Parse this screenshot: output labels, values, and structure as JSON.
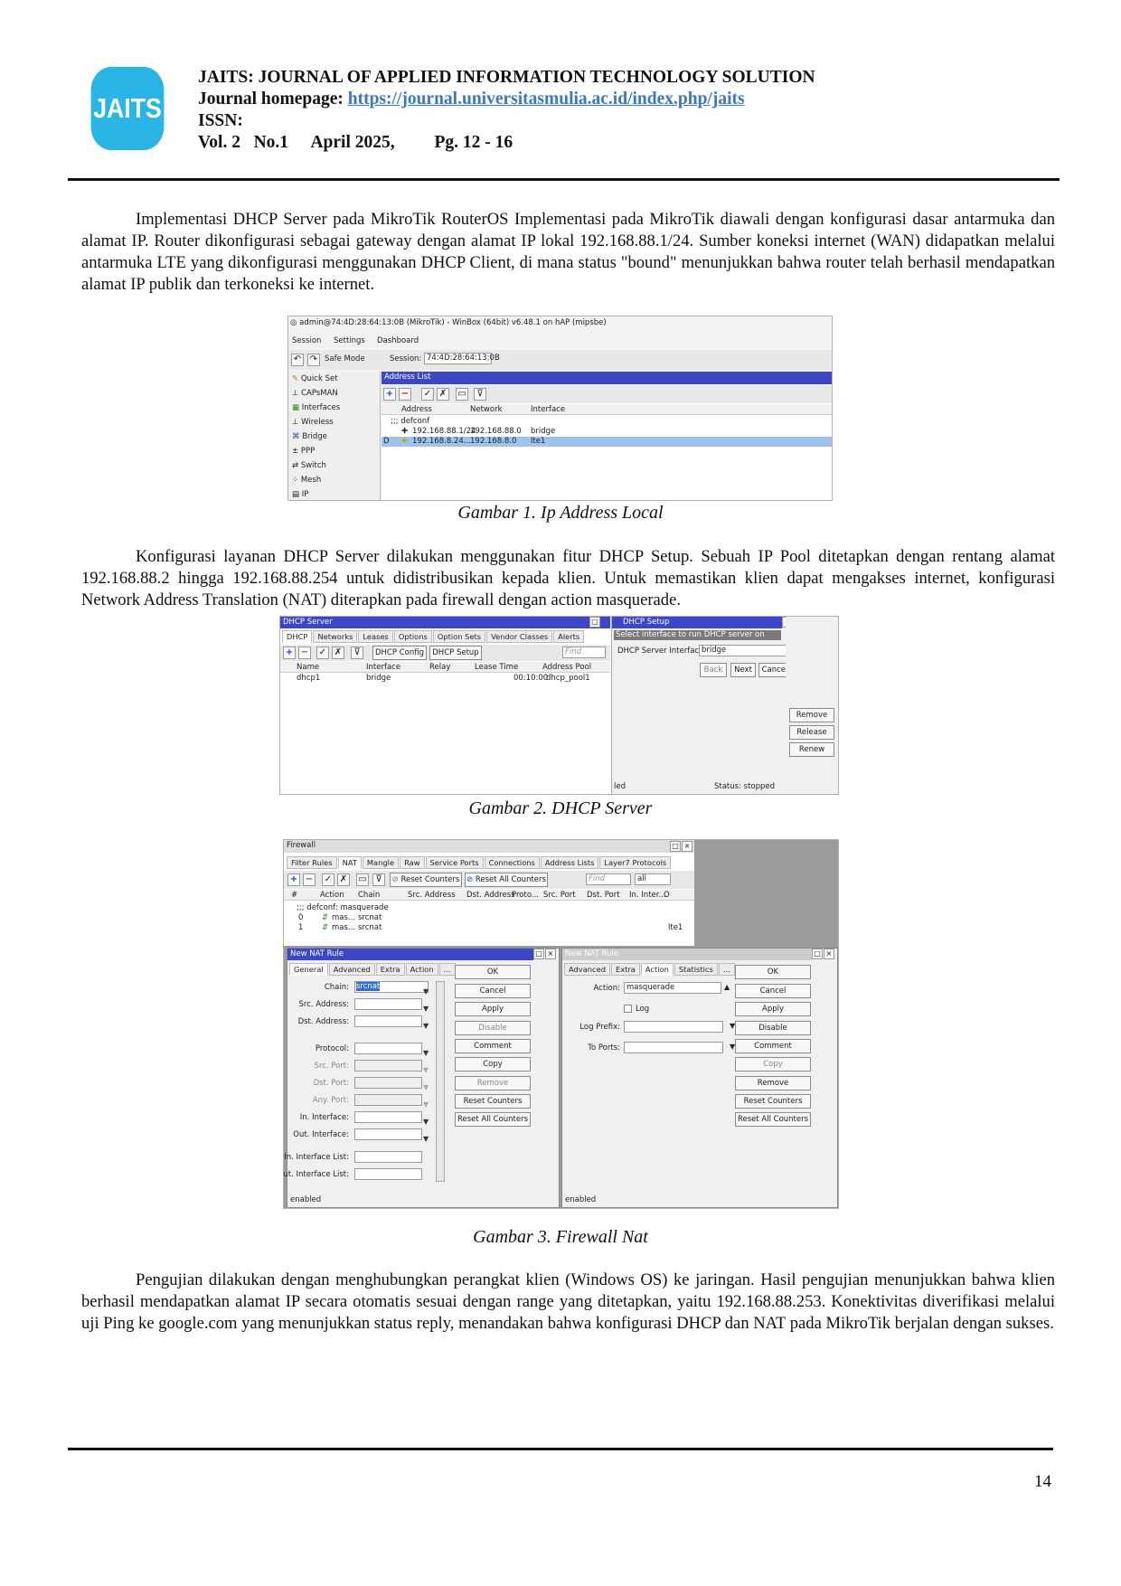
{
  "header": {
    "logo_text": "JAITS",
    "journal_title": "JAITS: JOURNAL OF APPLIED INFORMATION TECHNOLOGY SOLUTION",
    "homepage_label": "Journal homepage: ",
    "homepage_url": "https://journal.universitasmulia.ac.id/index.php/jaits",
    "issn_label": "ISSN:",
    "volume": "Vol. 2",
    "number": "No.1",
    "date": "April 2025,",
    "pages": "Pg. 12 - 16"
  },
  "paragraphs": [
    "Implementasi DHCP Server pada MikroTik RouterOS Implementasi pada MikroTik diawali dengan konfigurasi dasar antarmuka dan alamat IP. Router dikonfigurasi sebagai gateway dengan alamat IP lokal 192.168.88.1/24. Sumber koneksi internet (WAN) didapatkan melalui antarmuka LTE yang dikonfigurasi menggunakan DHCP Client, di mana status \"bound\" menunjukkan bahwa router telah berhasil mendapatkan alamat IP publik dan terkoneksi ke internet.",
    "Konfigurasi layanan DHCP Server dilakukan menggunakan fitur DHCP Setup. Sebuah IP Pool ditetapkan dengan rentang alamat 192.168.88.2 hingga 192.168.88.254 untuk didistribusikan kepada klien. Untuk memastikan klien dapat mengakses internet, konfigurasi Network Address Translation (NAT) diterapkan pada firewall dengan action masquerade.",
    "Pengujian dilakukan dengan menghubungkan perangkat klien (Windows OS) ke jaringan. Hasil pengujian menunjukkan bahwa klien berhasil mendapatkan alamat IP secara otomatis sesuai dengan range yang ditetapkan, yaitu 192.168.88.253. Konektivitas diverifikasi melalui uji Ping ke google.com yang menunjukkan status reply, menandakan bahwa konfigurasi DHCP dan NAT pada MikroTik berjalan dengan sukses."
  ],
  "captions": [
    "Gambar 1. Ip Address Local",
    "Gambar 2. DHCP Server",
    "Gambar 3. Firewall Nat"
  ],
  "page_number": "14",
  "fig1": {
    "title": "admin@74:4D:28:64:13:0B (MikroTik) - WinBox (64bit) v6.48.1 on hAP (mipsbe)",
    "menu": [
      "Session",
      "Settings",
      "Dashboard"
    ],
    "safe_mode": "Safe Mode",
    "session_label": "Session:",
    "session_value": "74:4D:28:64:13:0B",
    "sidebar": [
      "Quick Set",
      "CAPsMAN",
      "Interfaces",
      "Wireless",
      "Bridge",
      "PPP",
      "Switch",
      "Mesh",
      "IP"
    ],
    "list_title": "Address List",
    "columns": [
      "Address",
      "Network",
      "Interface"
    ],
    "comment": ";;; defconf",
    "rows": [
      {
        "flag": "",
        "address": "192.168.88.1/24",
        "network": "192.168.88.0",
        "iface": "bridge"
      },
      {
        "flag": "D",
        "address": "192.168.8.24...",
        "network": "192.168.8.0",
        "iface": "lte1"
      }
    ]
  },
  "fig2": {
    "title": "DHCP Server",
    "tabs": [
      "DHCP",
      "Networks",
      "Leases",
      "Options",
      "Option Sets",
      "Vendor Classes",
      "Alerts"
    ],
    "toolbar": [
      "DHCP Config",
      "DHCP Setup"
    ],
    "find": "Find",
    "columns": [
      "Name",
      "Interface",
      "Relay",
      "Lease Time",
      "Address Pool"
    ],
    "row": {
      "name": "dhcp1",
      "iface": "bridge",
      "lease": "00:10:00",
      "pool": "dhcp_pool1"
    },
    "setup_title": "DHCP Setup",
    "setup_prompt": "Select interface to run DHCP server on",
    "setup_label": "DHCP Server Interface:",
    "setup_value": "bridge",
    "setup_buttons": [
      "Back",
      "Next",
      "Cancel"
    ],
    "side_buttons": [
      "Remove",
      "Release",
      "Renew"
    ],
    "status_left": "led",
    "status_right": "Status: stopped"
  },
  "fig3": {
    "title": "Firewall",
    "tabs": [
      "Filter Rules",
      "NAT",
      "Mangle",
      "Raw",
      "Service Ports",
      "Connections",
      "Address Lists",
      "Layer7 Protocols"
    ],
    "toolbar": [
      "Reset Counters",
      "Reset All Counters"
    ],
    "find": "Find",
    "filter": "all",
    "columns": [
      "#",
      "Action",
      "Chain",
      "Src. Address",
      "Dst. Address",
      "Proto...",
      "Src. Port",
      "Dst. Port",
      "In. Inter...",
      "O"
    ],
    "comment": ";;; defconf: masquerade",
    "rows": [
      {
        "num": "0",
        "action": "mas...",
        "chain": "srcnat",
        "out": ""
      },
      {
        "num": "1",
        "action": "mas...",
        "chain": "srcnat",
        "out": "lte1"
      }
    ],
    "left": {
      "title": "New NAT Rule",
      "tabs": [
        "General",
        "Advanced",
        "Extra",
        "Action",
        "..."
      ],
      "fields": [
        "Chain:",
        "Src. Address:",
        "Dst. Address:",
        "Protocol:",
        "Src. Port:",
        "Dst. Port:",
        "Any. Port:",
        "In. Interface:",
        "Out. Interface:",
        "In. Interface List:",
        "Out. Interface List:"
      ],
      "chain_value": "srcnat",
      "buttons": [
        "OK",
        "Cancel",
        "Apply",
        "Disable",
        "Comment",
        "Copy",
        "Remove",
        "Reset Counters",
        "Reset All Counters"
      ],
      "status": "enabled"
    },
    "right": {
      "title": "New NAT Rule",
      "tabs": [
        "Advanced",
        "Extra",
        "Action",
        "Statistics",
        "..."
      ],
      "action_label": "Action:",
      "action_value": "masquerade",
      "log_label": "Log",
      "log_prefix_label": "Log Prefix:",
      "to_ports_label": "To Ports:",
      "buttons": [
        "OK",
        "Cancel",
        "Apply",
        "Disable",
        "Comment",
        "Copy",
        "Remove",
        "Reset Counters",
        "Reset All Counters"
      ],
      "status": "enabled"
    }
  }
}
